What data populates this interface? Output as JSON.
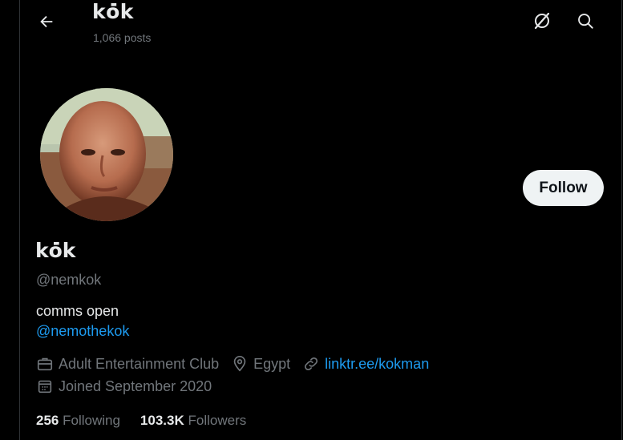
{
  "header": {
    "title": "kȯ̇k",
    "posts_count": "1,066 posts"
  },
  "profile": {
    "display_name": "kȯ̇k",
    "handle": "@nemkok",
    "bio": "comms open",
    "bio_link": "@nemothekok",
    "category": "Adult Entertainment Club",
    "location": "Egypt",
    "website": "linktr.ee/kokman",
    "joined": "Joined September 2020",
    "follow_label": "Follow"
  },
  "stats": {
    "following_count": "256",
    "following_label": "Following",
    "followers_count": "103.3K",
    "followers_label": "Followers"
  },
  "icons": {
    "back": "arrow-left-icon",
    "grok": "grok-icon",
    "search": "search-icon",
    "category": "briefcase-icon",
    "location": "location-pin-icon",
    "website": "link-icon",
    "joined": "calendar-icon"
  },
  "colors": {
    "background": "#000000",
    "text_primary": "#e7e9ea",
    "text_secondary": "#71767b",
    "link": "#1d9bf0",
    "follow_bg": "#eff3f4"
  }
}
